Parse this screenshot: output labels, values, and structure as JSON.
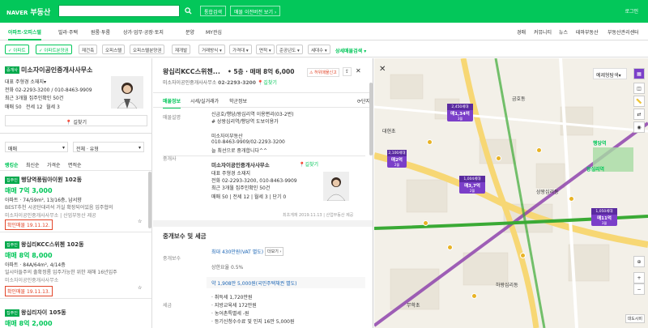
{
  "header": {
    "brand": "NAVER",
    "service": "부동산",
    "search_placeholder": "",
    "btn_complex": "통합검색",
    "btn_prev": "매물 이전버전 보기 ›",
    "login": "로그인"
  },
  "nav": {
    "items": [
      "아파트·오피스텔",
      "빌라·주택",
      "원룸·투룸",
      "상가·업무·공장·토지",
      "분양",
      "MY관심"
    ],
    "right": [
      "경매",
      "커뮤니티",
      "뉴스",
      "테마부동산",
      "부동산관리센터"
    ]
  },
  "filters": {
    "chips": [
      "아파트",
      "아파트분양권",
      "재건축",
      "오피스텔",
      "오피스텔분양권",
      "재개발",
      "거래방식",
      "가격대",
      "면적",
      "준공년도",
      "세대수"
    ],
    "detail": "상세매물검색"
  },
  "agent_card": {
    "badge": "중개사",
    "name": "미소자이공인중개사사무소",
    "rep": "대표 주형경 소재지▾",
    "phone": "전화 02-2293-3200 / 010-8463-9909",
    "career": "최근 3개월 집주인확인 50건",
    "stats": [
      "매매 50",
      "전세 12",
      "월세 3"
    ],
    "directions": "길찾기"
  },
  "list_filters": {
    "trade": "매매",
    "type": "전체 · 유형",
    "tabs": [
      "랭킹순",
      "최신순",
      "가격순",
      "면적순"
    ]
  },
  "listings": [
    {
      "badge": "집주인",
      "name": "행당역풍림아이원 102동",
      "price": "매매 7억 3,000",
      "spec": "아파트 · 74/59m², 13/16층, 남서향",
      "desc": "BEST추천 시공단대리석 거실 확장되어있음 입주협의",
      "agent": "미소자이공인중개사사무소",
      "agent2": "산업부동산 제공",
      "date": "확인매물 19.11.12."
    },
    {
      "badge": "집주인",
      "name": "왕십리KCC스위첸 102동",
      "price": "매매 8억 8,000",
      "spec": "아파트 · 84A/64m², 4/14층",
      "desc": "일시아들주의 출확정롬 입주가능한 위한 재해 16년입주",
      "agent": "미소자이공인중개사사무소",
      "agent2": "",
      "date": "확인매물 19.11.13."
    },
    {
      "badge": "집주인",
      "name": "왕십리자이 105동",
      "price": "매매 8억 2,000",
      "spec": "",
      "desc": "",
      "agent": "",
      "agent2": "",
      "date": ""
    }
  ],
  "detail": {
    "title": "왕십리KCC스위첸...",
    "summary": "• 5층 · 매매 8억 6,000",
    "report": "허위매물신고",
    "office": "미소자이공인중개사사무소",
    "office_phone": "02-2293-3200",
    "tabs": [
      "매물정보",
      "시세/실거래가",
      "학군정보"
    ],
    "tab_right": "단지",
    "desc_label": "매물설명",
    "desc_lines": [
      "신금호/행당/왕십리역 이용편리(03-2번)",
      "# 상왕십리역/행당역 도보이용가",
      "",
      "미소자이부동산",
      "010-8463-9909/02-2293-3200",
      "늘 최선으로 중개합니다^^"
    ],
    "broker_label": "중개사",
    "broker_name": "미소자이공인중개사사무소",
    "broker_dir": "길찾기",
    "broker_rep": "대표 주형경 소재지",
    "broker_phone": "전화 02-2293-3200, 010-8463-9909",
    "broker_career": "최근 3개월 집주인확인 50건",
    "broker_stats": [
      "매매 50",
      "전세 12",
      "월세 3",
      "단기 0"
    ],
    "source": "최초게재 2019.11.13 | 산업부동산 제공",
    "fee_title": "중개보수 및 세금",
    "fee_label": "중개보수",
    "fee_max": "최대 430만원(VAT 별도)",
    "fee_more": "더보기 ›",
    "fee_rate_label": "상한요율 0.5%",
    "tax_bar": "약 1,908만 5,000원(국민주택채권 별도)",
    "tax_label": "세금",
    "tax_items": [
      "· 취득세 1,720만원",
      "· 지방교육세 172만원",
      "· 농어촌특별세 -원",
      "· 등기신청수수료 및 인지 16만 5,000원"
    ]
  },
  "map": {
    "pins": [
      {
        "head": "2,450세대",
        "price": "매1,34억",
        "sub": "3월"
      },
      {
        "head": "2,100세대",
        "price": "매2억",
        "sub": "2월"
      },
      {
        "head": "1,004세대",
        "price": "매3,7억",
        "sub": "2월"
      },
      {
        "head": "1,050세대",
        "price": "매11억",
        "sub": "3월"
      }
    ],
    "labels": [
      "행당역",
      "왕십리역",
      "왕십리역",
      "무학초",
      "대현초",
      "금호동",
      "상왕십리동",
      "하왕십리동"
    ],
    "controls": [
      "예제형탐색▾",
      "지적",
      "거리",
      "길찾기"
    ],
    "scale": "대도시비"
  }
}
